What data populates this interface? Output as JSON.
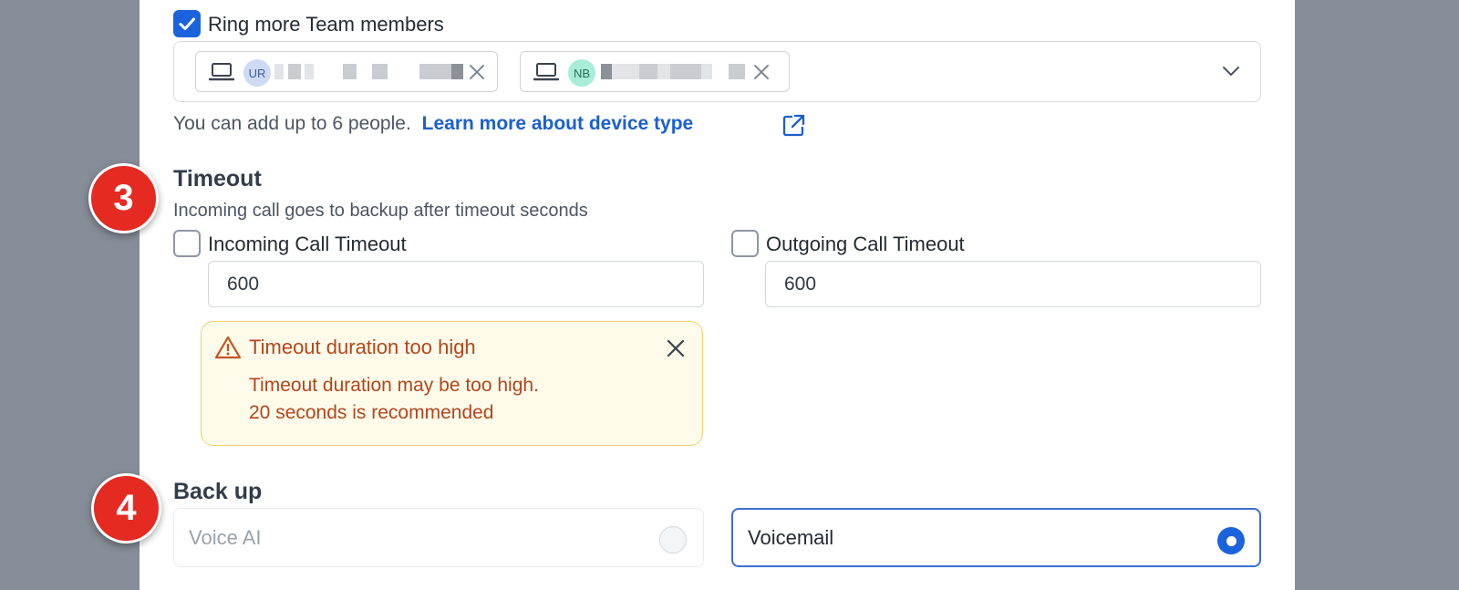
{
  "ring_more": {
    "label": "Ring more Team members",
    "checked": true
  },
  "members": [
    {
      "initials": "UR",
      "avatar_bg": "#cfdaf5",
      "avatar_fg": "#3f5b9c"
    },
    {
      "initials": "NB",
      "avatar_bg": "#a8ecd9",
      "avatar_fg": "#2b6b59"
    }
  ],
  "helper": {
    "text": "You can add up to 6 people.",
    "link": "Learn more about device type"
  },
  "timeout": {
    "step": "3",
    "title": "Timeout",
    "subtitle": "Incoming call goes to backup after timeout seconds",
    "incoming": {
      "label": "Incoming Call Timeout",
      "value": "600",
      "checked": false
    },
    "outgoing": {
      "label": "Outgoing Call Timeout",
      "value": "600",
      "checked": false
    },
    "warning": {
      "title": "Timeout duration too high",
      "line1": "Timeout duration may be too high.",
      "line2": "20 seconds is recommended"
    }
  },
  "backup": {
    "step": "4",
    "title": "Back up",
    "options": [
      {
        "label": "Voice AI",
        "selected": false
      },
      {
        "label": "Voicemail",
        "selected": true
      }
    ]
  },
  "colors": {
    "accent": "#1b63dc",
    "link": "#1b5fcf",
    "warning_text": "#b4451a",
    "warning_bg": "#fffbeb",
    "step_badge": "#e52a21"
  }
}
